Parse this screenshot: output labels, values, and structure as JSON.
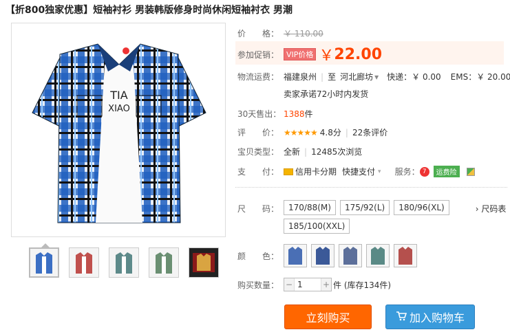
{
  "title": {
    "promo": "【折800独家优惠】",
    "name": "短袖衬衫 男装韩版修身时尚休闲短袖衬衣 男潮"
  },
  "price": {
    "label": "价　　格：",
    "original": "￥ 110.00"
  },
  "promo": {
    "label": "参加促销：",
    "tag": "VIP价格",
    "currency": "￥",
    "value": "22.00"
  },
  "shipping": {
    "label": "物流运费：",
    "from": "福建泉州",
    "to_prefix": "至",
    "to": "河北廊坊",
    "express": "快递：￥ 0.00",
    "ems": "EMS：￥ 20.00",
    "promise": "卖家承诺72小时内发货"
  },
  "sales": {
    "label": "30天售出：",
    "count": "1388",
    "unit": "件"
  },
  "rating": {
    "label": "评　　价：",
    "stars": "★★★★★",
    "score": "4.8分",
    "reviews": "22条评价"
  },
  "type": {
    "label": "宝贝类型：",
    "condition": "全新",
    "views": "12485次浏览"
  },
  "payment": {
    "label": "支　　付：",
    "credit": "信用卡分期",
    "quick": "快捷支付",
    "service_label": "服务：",
    "shipping_insurance": "运费险"
  },
  "size": {
    "label": "尺　　码：",
    "options": [
      "170/88(M)",
      "175/92(L)",
      "180/96(XL)",
      "185/100(XXL)"
    ],
    "chart_link": "› 尺码表"
  },
  "color": {
    "label": "颜　　色：",
    "count": 5
  },
  "quantity": {
    "label": "购买数量：",
    "value": "1",
    "stock": "件 (库存134件)"
  },
  "actions": {
    "buy": "立刻购买",
    "cart": "加入购物车"
  },
  "colors": {
    "accent": "#ff4400",
    "buy": "#ff6600",
    "cart": "#3a9bdc"
  }
}
